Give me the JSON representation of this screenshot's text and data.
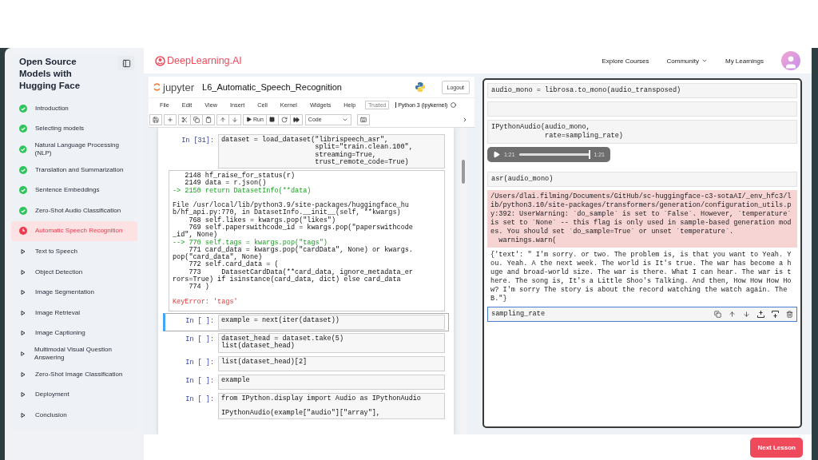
{
  "sidebar": {
    "title": "Open Source Models with Hugging Face",
    "items": [
      {
        "label": "Introduction",
        "kind": "done",
        "selected": false
      },
      {
        "label": "Selecting models",
        "kind": "done",
        "selected": false
      },
      {
        "label": "Natural Language Processing (NLP)",
        "kind": "done",
        "selected": false
      },
      {
        "label": "Translation and Summarization",
        "kind": "done",
        "selected": false
      },
      {
        "label": "Sentence Embeddings",
        "kind": "done",
        "selected": false
      },
      {
        "label": "Zero-Shot Audio Classification",
        "kind": "done",
        "selected": false
      },
      {
        "label": "Automatic Speech Recognition",
        "kind": "current",
        "selected": true
      },
      {
        "label": "Text to Speech",
        "kind": "pending",
        "selected": false
      },
      {
        "label": "Object Detection",
        "kind": "pending",
        "selected": false
      },
      {
        "label": "Image Segmentation",
        "kind": "pending",
        "selected": false
      },
      {
        "label": "Image Retrieval",
        "kind": "pending",
        "selected": false
      },
      {
        "label": "Image Captioning",
        "kind": "pending",
        "selected": false
      },
      {
        "label": "Multimodal Visual Question Answering",
        "kind": "pending",
        "selected": false
      },
      {
        "label": "Zero-Shot Image Classification",
        "kind": "pending",
        "selected": false
      },
      {
        "label": "Deployment",
        "kind": "pending",
        "selected": false
      },
      {
        "label": "Conclusion",
        "kind": "pending",
        "selected": false
      }
    ]
  },
  "header": {
    "brand": "DeepLearning.AI",
    "nav": [
      {
        "label": "Explore Courses",
        "dropdown": false
      },
      {
        "label": "Community",
        "dropdown": true
      },
      {
        "label": "My Learnings",
        "dropdown": false
      }
    ]
  },
  "notebook": {
    "logo": "jupyter",
    "title": "L6_Automatic_Speech_Recognition",
    "logout": "Logout",
    "menu": [
      "File",
      "Edit",
      "View",
      "Insert",
      "Cell",
      "Kernel",
      "Widgets",
      "Help"
    ],
    "trusted": "Trusted",
    "kernel": "Python 3 (ipykernel)",
    "run": "Run",
    "cell_type": "Code",
    "cells": [
      {
        "prompt": "In [31]:",
        "selected": false,
        "code": "dataset = load_dataset(\"librispeech_asr\",\n                       split=\"train.clean.100\",\n                       streaming=True,\n                       trust_remote_code=True)",
        "output": [
          {
            "kind": "trace",
            "text": "   2148 hf_raise_for_status(r)\n   2149 data = r.json()"
          },
          {
            "kind": "arrow",
            "text": "-> 2150 return DatasetInfo(**data)"
          },
          {
            "kind": "file",
            "text": "File /usr/local/lib/python3.9/site-packages/huggingface_hu\nb/hf_api.py:770, in DatasetInfo.__init__(self, **kwargs)"
          },
          {
            "kind": "trace",
            "text": "    768 self.likes = kwargs.pop(\"likes\")\n    769 self.paperswithcode_id = kwargs.pop(\"paperswithcode\n_id\", None)"
          },
          {
            "kind": "arrow",
            "text": "--> 770 self.tags = kwargs.pop(\"tags\")"
          },
          {
            "kind": "trace",
            "text": "    771 card_data = kwargs.pop(\"cardData\", None) or kwargs.\npop(\"card_data\", None)\n    772 self.card_data = (\n    773     DatasetCardData(**card_data, ignore_metadata_er\nrors=True) if isinstance(card_data, dict) else card_data\n    774 )"
          },
          {
            "kind": "error",
            "text": "KeyError: 'tags'"
          }
        ]
      },
      {
        "prompt": "In [ ]:",
        "selected": true,
        "code": "example = next(iter(dataset))"
      },
      {
        "prompt": "In [ ]:",
        "selected": false,
        "code": "dataset_head = dataset.take(5)\nlist(dataset_head)"
      },
      {
        "prompt": "In [ ]:",
        "selected": false,
        "code": "list(dataset_head)[2]"
      },
      {
        "prompt": "In [ ]:",
        "selected": false,
        "code": "example"
      },
      {
        "prompt": "In [ ]:",
        "selected": false,
        "code": "from IPython.display import Audio as IPythonAudio\n\nIPythonAudio(example[\"audio\"][\"array\"],"
      }
    ]
  },
  "lesson": {
    "cells": [
      {
        "kind": "code",
        "selected": false,
        "code": "audio_mono = librosa.to_mono(audio_transposed)"
      },
      {
        "kind": "code",
        "selected": false
      },
      {
        "kind": "code",
        "selected": false,
        "code": "IPythonAudio(audio_mono,\n             rate=sampling_rate)"
      },
      {
        "kind": "audio",
        "elapsed": "1:21",
        "duration": "1:21",
        "level": 1
      },
      {
        "kind": "code",
        "selected": false,
        "code": "asr(audio_mono)"
      },
      {
        "kind": "stderr",
        "text": "/Users/dlai.filming/Documents/GitHub/sc-huggingface-c3-sotaAI/_env_hfc3/l\nib/python3.10/site-packages/transformers/generation/configuration_utils.p\ny:392: UserWarning: `do_sample` is set to `False`. However, `temperature`\nis set to `None` -- this flag is only used in sample-based generation mod\nes. You should set `do_sample=True` or unset `temperature`.\n  warnings.warn("
      },
      {
        "kind": "stdout",
        "text": "{'text': \" I'm sorry. or two. The problem is, is that you want to Yeah. Y\nou. Yeah. A the next week. The world is It's true. The war has become a h\nuge and broad-world size. The war is there. What I can hear. The war is t\nhere. The song is, It's a Little Shoo's Talking. And then, How How How Ho\nw? I'm sorry The story is about the record watching the watch again. The\nB.\"}"
      },
      {
        "kind": "code",
        "selected": true,
        "code": "sampling_rate"
      }
    ]
  },
  "next_button": "Next Lesson"
}
